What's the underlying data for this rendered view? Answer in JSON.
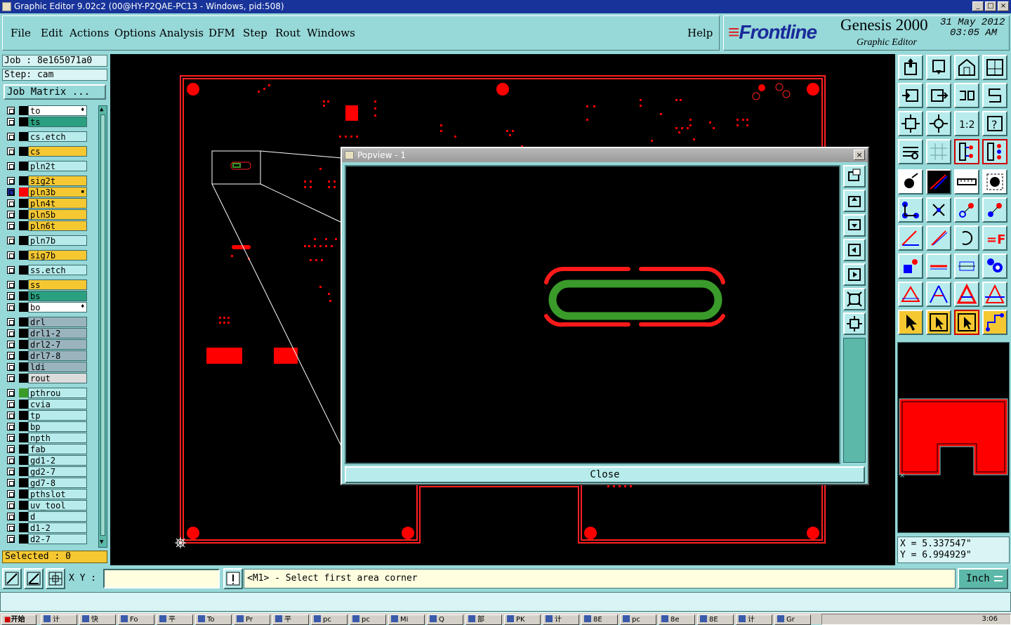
{
  "window": {
    "title": "Graphic Editor 9.02c2 (00@HY-P2QAE-PC13 - Windows, pid:508)"
  },
  "menu": {
    "items": [
      "File",
      "Edit",
      "Actions",
      "Options",
      "Analysis",
      "DFM",
      "Step",
      "Rout",
      "Windows"
    ],
    "help": "Help"
  },
  "brand": {
    "logo": "Frontline",
    "product": "Genesis 2000",
    "subtitle": "Graphic Editor",
    "date": "31 May 2012",
    "time": "03:05 AM"
  },
  "job": {
    "job_line": "Job : 8e165071a0",
    "step_line": "Step: cam",
    "matrix_button": "Job Matrix ..."
  },
  "layers": [
    {
      "name": "to",
      "bg": "#ffffff",
      "mark": "#000000",
      "flag": "♦"
    },
    {
      "name": "ts",
      "bg": "#2aa080",
      "mark": "#000000"
    },
    {
      "name": "cs.etch",
      "bg": "#b8ecec",
      "mark": "#000000"
    },
    {
      "name": "cs",
      "bg": "#f5c832",
      "mark": "#000000"
    },
    {
      "name": "pln2t",
      "bg": "#b8ecec",
      "mark": "#000000"
    },
    {
      "name": "sig2t",
      "bg": "#f5c832",
      "mark": "#000000"
    },
    {
      "name": "pln3b",
      "bg": "#f5c832",
      "mark": "#ff0000",
      "flag": "▪"
    },
    {
      "name": "pln4t",
      "bg": "#f5c832",
      "mark": "#000000"
    },
    {
      "name": "pln5b",
      "bg": "#f5c832",
      "mark": "#000000"
    },
    {
      "name": "pln6t",
      "bg": "#f5c832",
      "mark": "#000000"
    },
    {
      "name": "pln7b",
      "bg": "#b8ecec",
      "mark": "#000000"
    },
    {
      "name": "sig7b",
      "bg": "#f5c832",
      "mark": "#000000"
    },
    {
      "name": "ss.etch",
      "bg": "#b8ecec",
      "mark": "#000000"
    },
    {
      "name": "ss",
      "bg": "#f5c832",
      "mark": "#000000"
    },
    {
      "name": "bs",
      "bg": "#2aa080",
      "mark": "#000000"
    },
    {
      "name": "bo",
      "bg": "#ffffff",
      "mark": "#000000",
      "flag": "♦"
    },
    {
      "name": "drl",
      "bg": "#9ab4be",
      "mark": "#000000"
    },
    {
      "name": "drl1-2",
      "bg": "#9ab4be",
      "mark": "#000000"
    },
    {
      "name": "drl2-7",
      "bg": "#9ab4be",
      "mark": "#000000"
    },
    {
      "name": "drl7-8",
      "bg": "#9ab4be",
      "mark": "#000000"
    },
    {
      "name": "ldi",
      "bg": "#9ab4be",
      "mark": "#000000"
    },
    {
      "name": "rout",
      "bg": "#dcdcdc",
      "mark": "#000000"
    },
    {
      "name": "pthrou",
      "bg": "#b8ecec",
      "mark": "#3a9a2a"
    },
    {
      "name": "cvia",
      "bg": "#b8ecec",
      "mark": "#000000"
    },
    {
      "name": "tp",
      "bg": "#b8ecec",
      "mark": "#000000"
    },
    {
      "name": "bp",
      "bg": "#b8ecec",
      "mark": "#000000"
    },
    {
      "name": "npth",
      "bg": "#b8ecec",
      "mark": "#000000"
    },
    {
      "name": "fab",
      "bg": "#b8ecec",
      "mark": "#000000"
    },
    {
      "name": "gd1-2",
      "bg": "#b8ecec",
      "mark": "#000000"
    },
    {
      "name": "gd2-7",
      "bg": "#b8ecec",
      "mark": "#000000"
    },
    {
      "name": "gd7-8",
      "bg": "#b8ecec",
      "mark": "#000000"
    },
    {
      "name": "pthslot",
      "bg": "#b8ecec",
      "mark": "#000000"
    },
    {
      "name": "uv_tool",
      "bg": "#b8ecec",
      "mark": "#000000"
    },
    {
      "name": "d",
      "bg": "#b8ecec",
      "mark": "#000000"
    },
    {
      "name": "d1-2",
      "bg": "#b8ecec",
      "mark": "#000000"
    },
    {
      "name": "d2-7",
      "bg": "#b8ecec",
      "mark": "#000000"
    }
  ],
  "selected": "Selected : 0",
  "popview": {
    "title": "Popview - 1",
    "close": "Close"
  },
  "coords": {
    "x": "X = 5.337547\"",
    "y": "Y = 6.994929\""
  },
  "bottom": {
    "xy_label": "X Y :",
    "xy_value": "",
    "prompt": "<M1> - Select first area corner",
    "units": "Inch"
  },
  "taskbar": {
    "start": "开始",
    "time": "3:06",
    "tasks": [
      "计",
      "快",
      "Fo",
      "平",
      "To",
      "Pr",
      "平",
      "pc",
      "pc",
      "Mi",
      "Q",
      "部",
      "PK",
      "计",
      "8E",
      "pc",
      "8e",
      "8E",
      "计",
      "Gr"
    ]
  },
  "colors": {
    "accent": "#97d8d8",
    "pcb_red": "#ff0000",
    "layer_green": "#3a9a2a",
    "orange_layer": "#f5c832"
  }
}
